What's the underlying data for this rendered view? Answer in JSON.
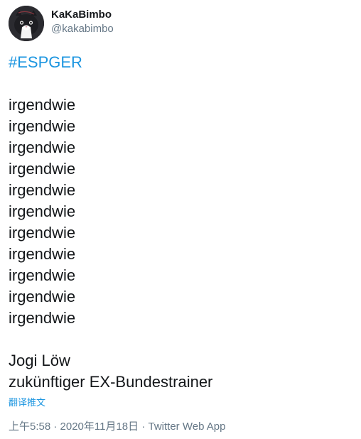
{
  "user": {
    "display_name": "KaKaBimbo",
    "handle": "@kakabimbo",
    "avatar_icon": "cat-avatar"
  },
  "tweet": {
    "hashtag": "#ESPGER",
    "lines": [
      "irgendwie",
      "irgendwie",
      "irgendwie",
      "irgendwie",
      "irgendwie",
      "irgendwie",
      "irgendwie",
      "irgendwie",
      "irgendwie",
      "irgendwie",
      "irgendwie"
    ],
    "signature_line1": "Jogi Löw",
    "signature_line2": "zukünftiger EX-Bundestrainer",
    "translate_link": "翻译推文"
  },
  "meta": {
    "timestamp": "上午5:58 · 2020年11月18日",
    "separator": " · ",
    "source": "Twitter Web App"
  },
  "colors": {
    "link": "#1b95e0",
    "secondary_text": "#657786",
    "primary_text": "#14171a"
  }
}
